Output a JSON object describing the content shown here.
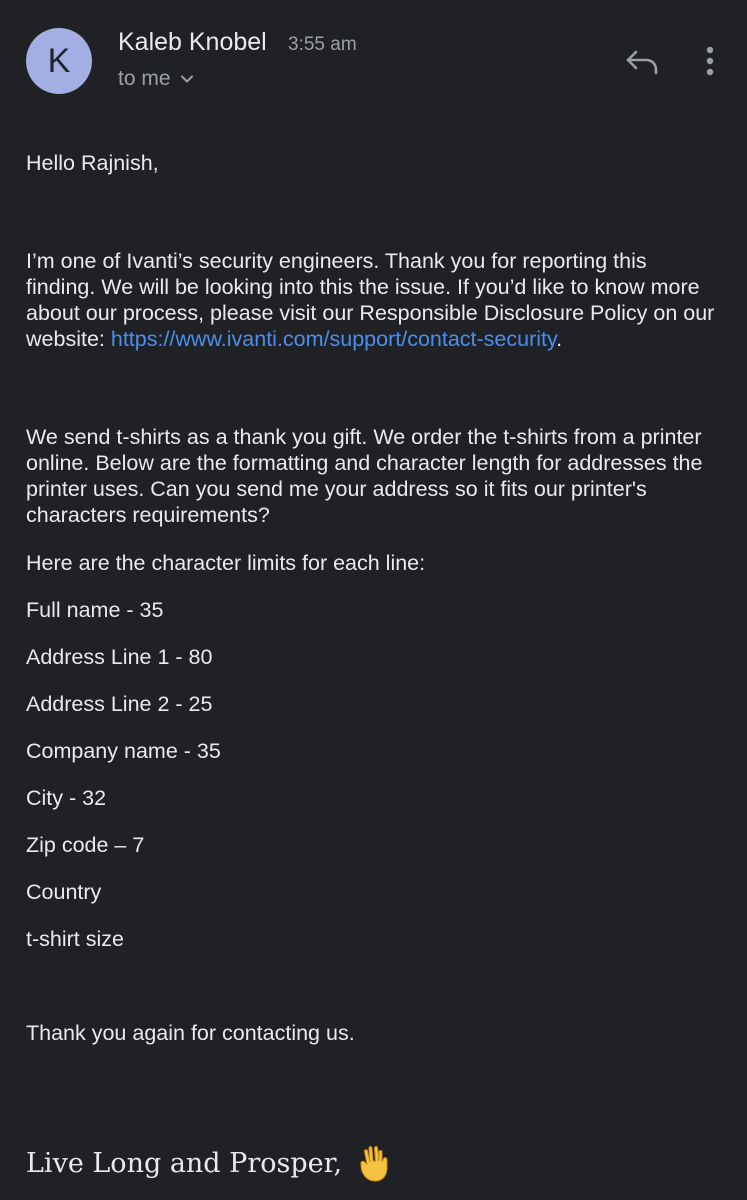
{
  "header": {
    "avatar_letter": "K",
    "sender_name": "Kaleb Knobel",
    "time": "3:55 am",
    "recipient": "to me",
    "icons": [
      "reply-icon",
      "more-vert-icon",
      "chevron-down-icon"
    ]
  },
  "colors": {
    "background": "#202124",
    "avatar": "#a3aee3",
    "link": "#4a8ff0",
    "text": "#e8eaed",
    "muted": "#9aa0a6"
  },
  "email": {
    "greeting": "Hello Rajnish,",
    "para1_text": "I’m one of Ivanti’s security engineers. Thank you for reporting this finding. We will be looking into this the issue. If you’d like to know more about our process, please visit our Responsible Disclosure Policy on our website: ",
    "para1_link": "https://www.ivanti.com/support/contact-security",
    "para1_end": ".",
    "para2": "We send t-shirts as a thank you gift. We order the t-shirts from a printer online. Below are the formatting and character length for addresses the printer uses. Can you send me your address so it fits our printer's characters requirements?",
    "limits_intro": "Here are the character limits for each line:",
    "limits": [
      "Full name - 35",
      "Address Line 1 - 80",
      "Address Line 2 - 25",
      "Company name - 35",
      "City - 32",
      "Zip code – 7",
      "Country",
      "t-shirt size"
    ],
    "thanks": "Thank you again for contacting us.",
    "signature": "Live Long and Prosper,",
    "signature_icon": "vulcan-salute-icon"
  }
}
